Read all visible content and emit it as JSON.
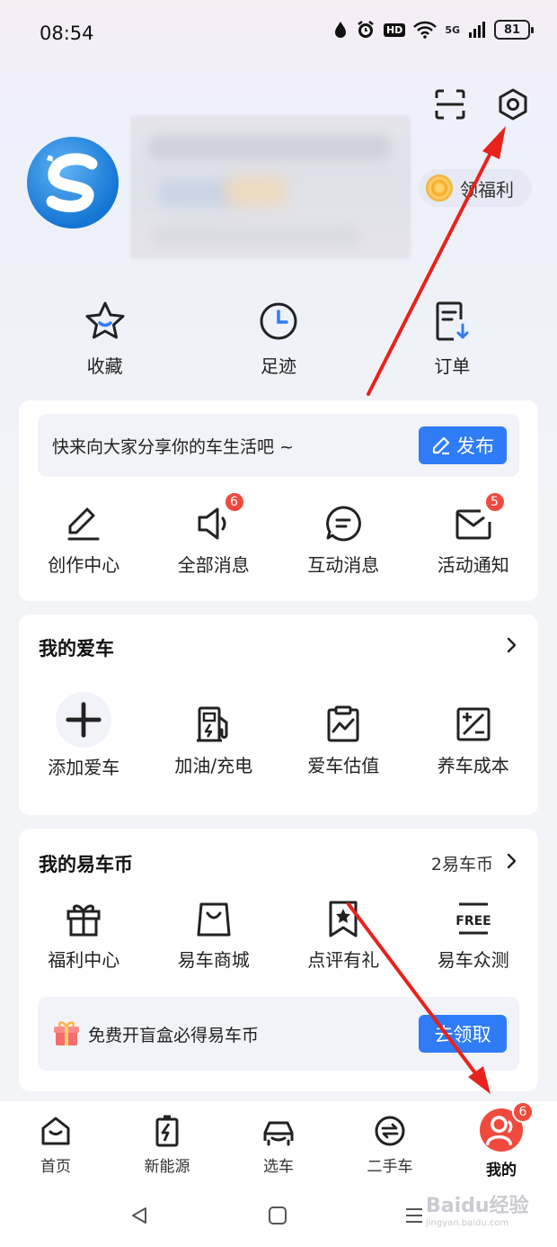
{
  "status_bar": {
    "time": "08:54",
    "network": "5G",
    "battery": "81",
    "hd": "HD"
  },
  "header": {
    "scan_icon": "scan-icon",
    "settings_icon": "gear-icon"
  },
  "profile": {
    "benefit_label": "领福利"
  },
  "quick_links": [
    {
      "label": "收藏",
      "icon": "star-icon"
    },
    {
      "label": "足迹",
      "icon": "clock-icon"
    },
    {
      "label": "订单",
      "icon": "order-icon"
    }
  ],
  "community": {
    "share_prompt": "快来向大家分享你的车生活吧 ~",
    "publish_label": "发布",
    "items": [
      {
        "label": "创作中心",
        "icon": "pen-icon"
      },
      {
        "label": "全部消息",
        "icon": "megaphone-icon",
        "badge": "6"
      },
      {
        "label": "互动消息",
        "icon": "chat-icon"
      },
      {
        "label": "活动通知",
        "icon": "mail-icon",
        "badge": "5"
      }
    ]
  },
  "my_car": {
    "title": "我的爱车",
    "items": [
      {
        "label": "添加爱车",
        "icon": "plus-icon"
      },
      {
        "label": "加油/充电",
        "icon": "fuel-icon"
      },
      {
        "label": "爱车估值",
        "icon": "valuation-icon"
      },
      {
        "label": "养车成本",
        "icon": "calculator-icon"
      }
    ]
  },
  "coins": {
    "title": "我的易车币",
    "balance": "2易车币",
    "items": [
      {
        "label": "福利中心",
        "icon": "gift-icon"
      },
      {
        "label": "易车商城",
        "icon": "bag-icon"
      },
      {
        "label": "点评有礼",
        "icon": "bookmark-star-icon"
      },
      {
        "label": "易车众测",
        "icon": "free-icon"
      }
    ],
    "promo_text": "免费开盲盒必得易车币",
    "claim_label": "去领取"
  },
  "bottom_nav": [
    {
      "label": "首页",
      "icon": "home-icon"
    },
    {
      "label": "新能源",
      "icon": "battery-bolt-icon"
    },
    {
      "label": "选车",
      "icon": "car-icon"
    },
    {
      "label": "二手车",
      "icon": "exchange-icon"
    },
    {
      "label": "我的",
      "icon": "user-icon",
      "badge": "6",
      "active": true
    }
  ],
  "watermark": {
    "text": "Baidu经验",
    "sub": "jingyan.baidu.com"
  },
  "colors": {
    "accent": "#2f7cf6",
    "badge": "#f04a3e",
    "annotation": "#e8221c"
  }
}
